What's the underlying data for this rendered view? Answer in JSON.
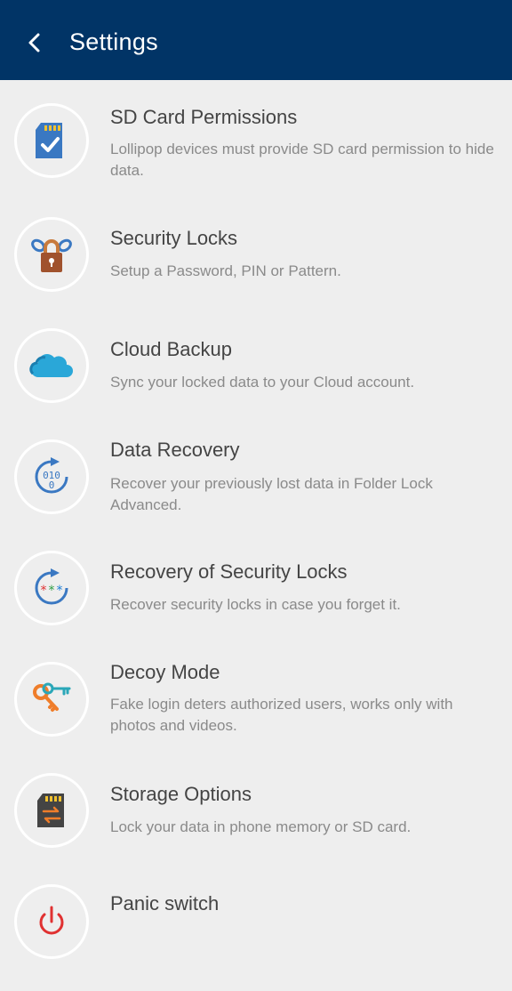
{
  "header": {
    "title": "Settings",
    "back_icon": "chevron-left-icon"
  },
  "colors": {
    "header_bg": "#013466",
    "list_bg": "#eeeeee",
    "title_text": "#444444",
    "subtitle_text": "#8a8a8a"
  },
  "settings": [
    {
      "title": "SD Card Permissions",
      "subtitle": "Lollipop devices must provide SD card permission to hide data.",
      "icon": "sd-card-check-icon"
    },
    {
      "title": "Security Locks",
      "subtitle": "Setup a Password, PIN or Pattern.",
      "icon": "padlock-chain-icon"
    },
    {
      "title": "Cloud Backup",
      "subtitle": "Sync your locked data to your Cloud account.",
      "icon": "cloud-icon"
    },
    {
      "title": "Data Recovery",
      "subtitle": "Recover your previously lost data in Folder Lock Advanced.",
      "icon": "binary-refresh-icon"
    },
    {
      "title": "Recovery of Security Locks",
      "subtitle": "Recover security locks in case you forget it.",
      "icon": "password-refresh-icon"
    },
    {
      "title": "Decoy Mode",
      "subtitle": "Fake login deters authorized users, works only with photos and videos.",
      "icon": "keys-icon"
    },
    {
      "title": "Storage Options",
      "subtitle": "Lock your data in phone memory or SD card.",
      "icon": "sd-card-transfer-icon"
    },
    {
      "title": "Panic switch",
      "subtitle": "",
      "icon": "power-icon"
    }
  ]
}
